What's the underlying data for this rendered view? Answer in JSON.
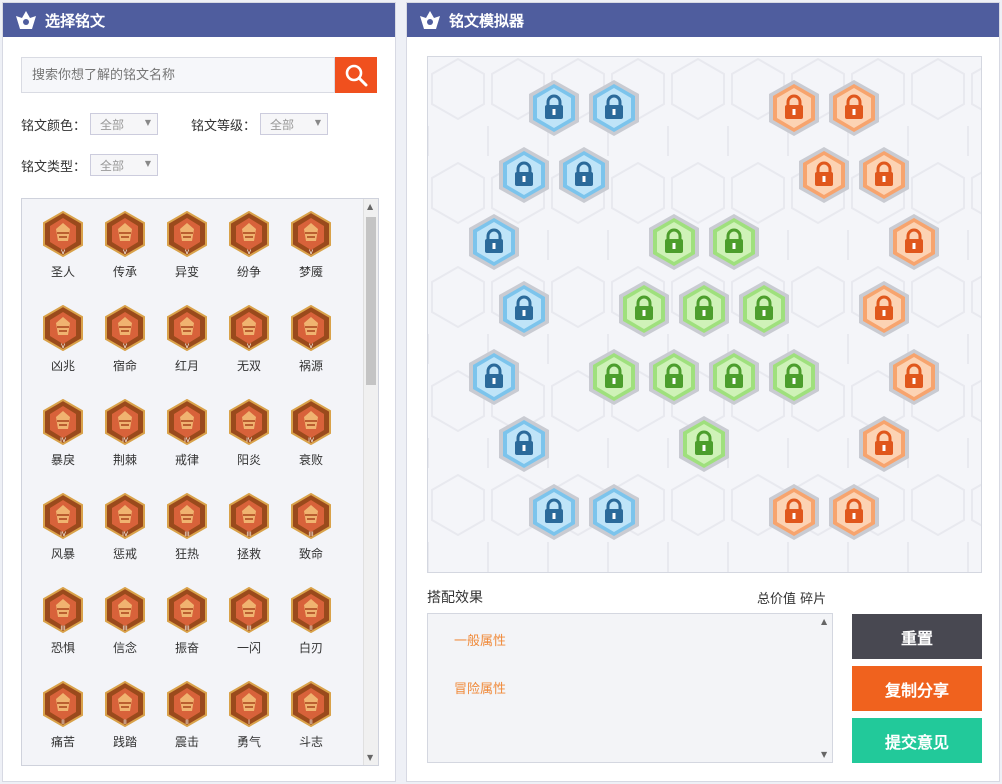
{
  "left_panel": {
    "title": "选择铭文",
    "search_placeholder": "搜索你想了解的铭文名称",
    "filters": {
      "color_label": "铭文颜色：",
      "color_value": "全部",
      "level_label": "铭文等级：",
      "level_value": "全部",
      "type_label": "铭文类型：",
      "type_value": "全部"
    },
    "items": [
      {
        "name": "圣人",
        "level": "V"
      },
      {
        "name": "传承",
        "level": "V"
      },
      {
        "name": "异变",
        "level": "V"
      },
      {
        "name": "纷争",
        "level": "V"
      },
      {
        "name": "梦魇",
        "level": "V"
      },
      {
        "name": "凶兆",
        "level": "V"
      },
      {
        "name": "宿命",
        "level": "V"
      },
      {
        "name": "红月",
        "level": "V"
      },
      {
        "name": "无双",
        "level": "V"
      },
      {
        "name": "祸源",
        "level": "V"
      },
      {
        "name": "暴戾",
        "level": "IV"
      },
      {
        "name": "荆棘",
        "level": "IV"
      },
      {
        "name": "戒律",
        "level": "IV"
      },
      {
        "name": "阳炎",
        "level": "IV"
      },
      {
        "name": "衰败",
        "level": "IV"
      },
      {
        "name": "风暴",
        "level": "IV"
      },
      {
        "name": "惩戒",
        "level": "IV"
      },
      {
        "name": "狂热",
        "level": "III"
      },
      {
        "name": "拯救",
        "level": "III"
      },
      {
        "name": "致命",
        "level": "III"
      },
      {
        "name": "恐惧",
        "level": "III"
      },
      {
        "name": "信念",
        "level": "III"
      },
      {
        "name": "振奋",
        "level": "III"
      },
      {
        "name": "一闪",
        "level": "III"
      },
      {
        "name": "白刃",
        "level": "II"
      },
      {
        "name": "痛苦",
        "level": "II"
      },
      {
        "name": "践踏",
        "level": "II"
      },
      {
        "name": "震击",
        "level": "II"
      },
      {
        "name": "勇气",
        "level": "I"
      },
      {
        "name": "斗志",
        "level": "II"
      }
    ]
  },
  "right_panel": {
    "title": "铭文模拟器",
    "combo_title": "搭配效果",
    "combo_right": "总价值 碎片",
    "combo_items": [
      "一般属性",
      "冒险属性"
    ],
    "buttons": {
      "reset": "重置",
      "copy": "复制分享",
      "feedback": "提交意见"
    }
  },
  "colors": {
    "header": "#4f5d9e",
    "accent_orange": "#f0621e",
    "teal": "#22c99a",
    "dark": "#484851",
    "slot_blue": "#7cc4ec",
    "slot_orange": "#f7a46e",
    "slot_green": "#9fe07d"
  },
  "slot_icon": "lock-icon"
}
